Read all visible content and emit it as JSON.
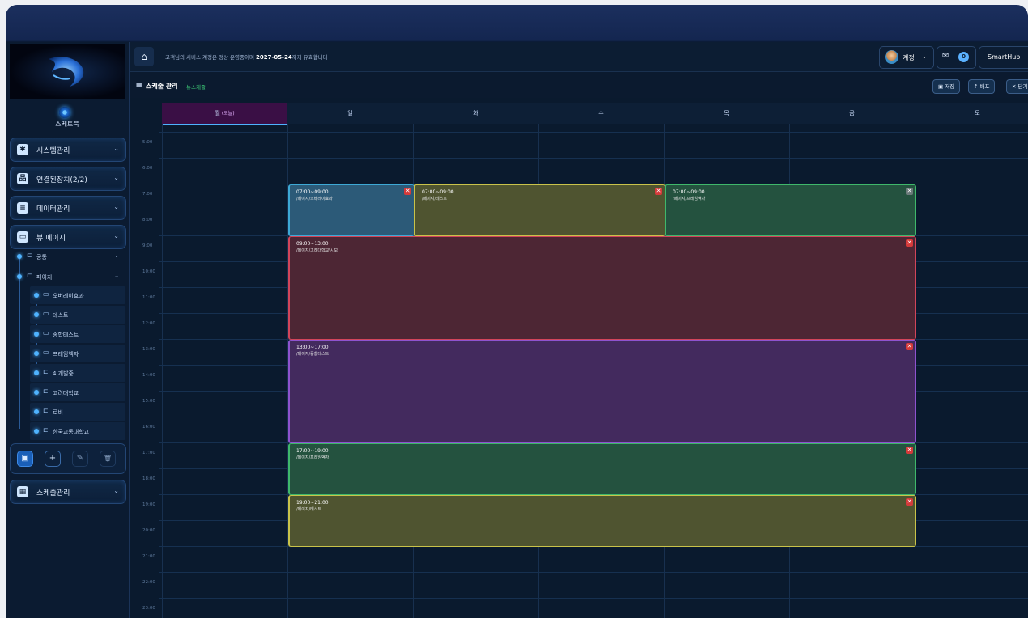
{
  "sidebar": {
    "profile_name": "스케트북",
    "menus": [
      {
        "label": "시스템관리",
        "icon": "gear-icon"
      },
      {
        "label": "연결된장치(2/2)",
        "icon": "sitemap-icon"
      },
      {
        "label": "데이터관리",
        "icon": "database-icon"
      },
      {
        "label": "뷰 페이지",
        "icon": "monitor-icon"
      },
      {
        "label": "스케줄관리",
        "icon": "calendar-icon"
      }
    ],
    "tree": [
      {
        "label": "공통",
        "type": "folder",
        "expandable": true
      },
      {
        "label": "페이지",
        "type": "folder",
        "expandable": true
      },
      {
        "label": "오버레이효과",
        "type": "page"
      },
      {
        "label": "테스트",
        "type": "page"
      },
      {
        "label": "종합테스트",
        "type": "page"
      },
      {
        "label": "프레임액자",
        "type": "page"
      },
      {
        "label": "4.개발중",
        "type": "folder"
      },
      {
        "label": "고려대학교",
        "type": "folder"
      },
      {
        "label": "로비",
        "type": "folder"
      },
      {
        "label": "한국교통대학교",
        "type": "folder"
      }
    ],
    "toolbar": {
      "add_folder": "▣",
      "add": "+",
      "edit": "✎",
      "delete": "🗑"
    }
  },
  "header": {
    "notice_prefix": "고객님의 서비스 계정은 정상 운영중이며 ",
    "notice_date": "2027-05-24",
    "notice_suffix": "까지 유효합니다",
    "user_name": "계정",
    "mail_badge": "0",
    "brand": "SmartHub"
  },
  "page": {
    "title": "스케줄 관리",
    "subtitle": "뉴스케줄",
    "buttons": {
      "save": "저장",
      "deploy": "배포",
      "close": "닫기"
    }
  },
  "calendar": {
    "days": [
      {
        "label": "월",
        "sub": "(오늘)",
        "today": true
      },
      {
        "label": "일"
      },
      {
        "label": "화"
      },
      {
        "label": "수"
      },
      {
        "label": "목"
      },
      {
        "label": "금"
      },
      {
        "label": "토"
      }
    ],
    "hours": [
      "5:00",
      "6:00",
      "7:00",
      "8:00",
      "9:00",
      "10:00",
      "11:00",
      "12:00",
      "13:00",
      "14:00",
      "15:00",
      "16:00",
      "17:00",
      "18:00",
      "19:00",
      "20:00",
      "21:00",
      "22:00",
      "23:00"
    ],
    "events": [
      {
        "time": "07:00~09:00",
        "path": "/페이지/오버레이효과",
        "start": 7,
        "end": 9,
        "col_start": 1,
        "col_end": 2,
        "color": "#2c5a78",
        "border": "#3da9d6"
      },
      {
        "time": "07:00~09:00",
        "path": "/페이지/테스트",
        "start": 7,
        "end": 9,
        "col_start": 2,
        "col_end": 4,
        "color": "#4f5430",
        "border": "#c9c34a"
      },
      {
        "time": "07:00~09:00",
        "path": "/페이지/프레임액자",
        "start": 7,
        "end": 9,
        "col_start": 4,
        "col_end": 6,
        "color": "#24523f",
        "border": "#3fb86b",
        "grey_close": true
      },
      {
        "time": "09:00~13:00",
        "path": "/페이지/고려대학교/시보",
        "start": 9,
        "end": 13,
        "col_start": 1,
        "col_end": 6,
        "color": "#4d2634",
        "border": "#d2455a"
      },
      {
        "time": "13:00~17:00",
        "path": "/페이지/종합테스트",
        "start": 13,
        "end": 17,
        "col_start": 1,
        "col_end": 6,
        "color": "#432a5e",
        "border": "#8e53cf"
      },
      {
        "time": "17:00~19:00",
        "path": "/페이지/프레임액자",
        "start": 17,
        "end": 19,
        "col_start": 1,
        "col_end": 6,
        "color": "#24523f",
        "border": "#3fb86b"
      },
      {
        "time": "19:00~21:00",
        "path": "/페이지/테스트",
        "start": 19,
        "end": 21,
        "col_start": 1,
        "col_end": 6,
        "color": "#4f5430",
        "border": "#c9c34a"
      }
    ]
  }
}
